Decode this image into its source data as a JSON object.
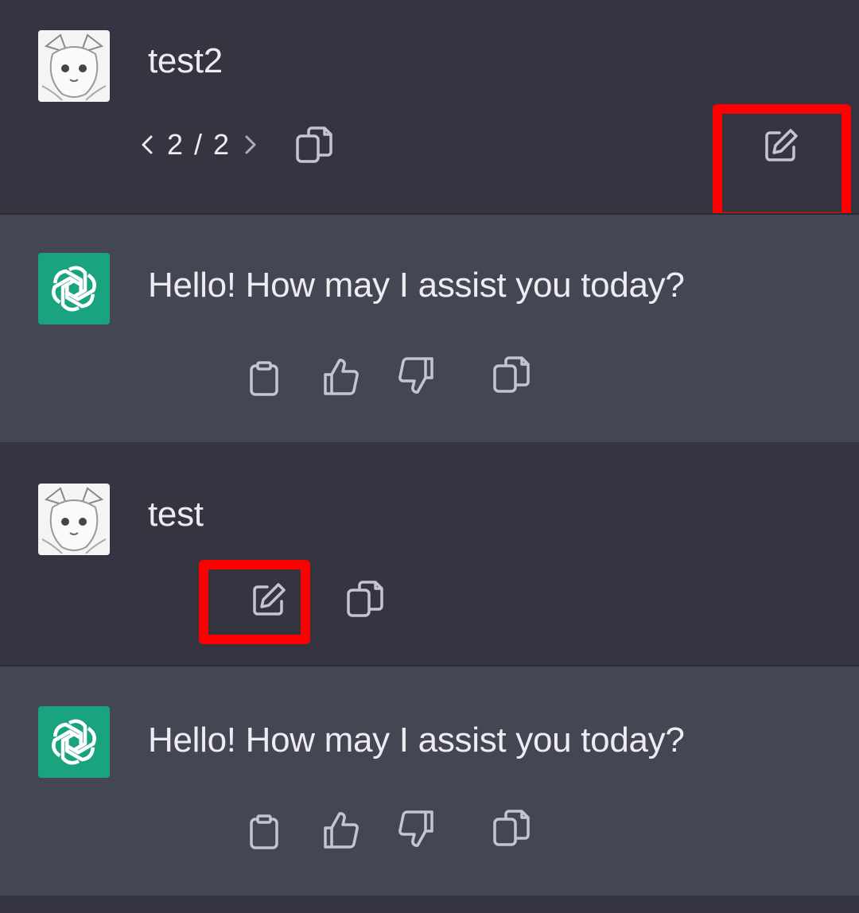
{
  "messages": [
    {
      "role": "user",
      "text": "test2",
      "pager": {
        "prev_icon": "chevron-left-icon",
        "count": "2 / 2",
        "next_icon": "chevron-right-icon"
      },
      "actions": [
        "copy-icon",
        "edit-icon"
      ]
    },
    {
      "role": "assistant",
      "text": "Hello! How may I assist you today?",
      "actions": [
        "clipboard-icon",
        "thumbs-up-icon",
        "thumbs-down-icon",
        "copy-icon"
      ]
    },
    {
      "role": "user",
      "text": "test",
      "actions": [
        "edit-icon",
        "copy-icon"
      ]
    },
    {
      "role": "assistant",
      "text": "Hello! How may I assist you today?",
      "actions": [
        "clipboard-icon",
        "thumbs-up-icon",
        "thumbs-down-icon",
        "copy-icon"
      ]
    }
  ],
  "colors": {
    "user_bg": "#343541",
    "assistant_bg": "#444654",
    "bot_avatar": "#19A37F",
    "highlight": "#FF0000",
    "icon": "#C5C5D2"
  }
}
